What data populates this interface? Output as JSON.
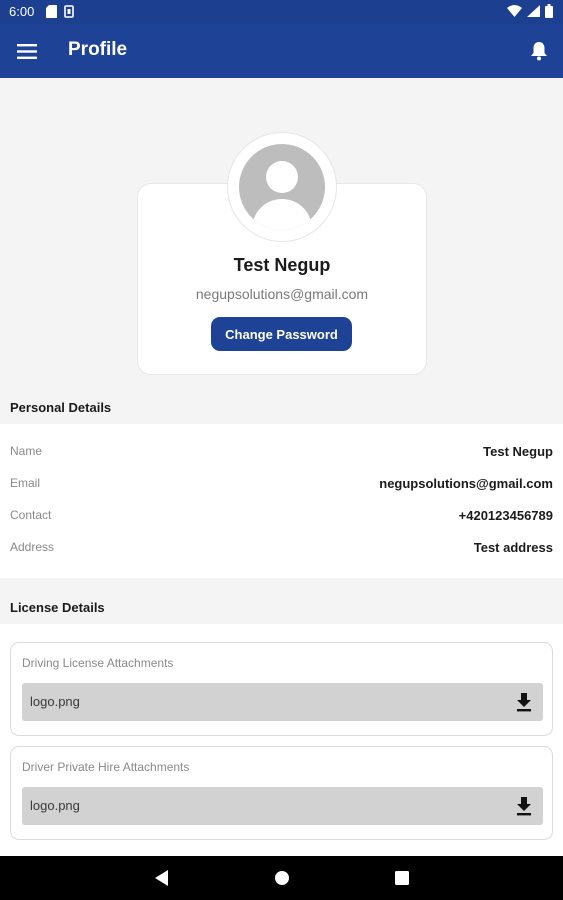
{
  "status_bar": {
    "time": "6:00"
  },
  "app_bar": {
    "title": "Profile"
  },
  "profile": {
    "name": "Test Negup",
    "email": "negupsolutions@gmail.com",
    "change_password_label": "Change Password"
  },
  "personal_details": {
    "title": "Personal Details",
    "rows": [
      {
        "label": "Name",
        "value": "Test Negup"
      },
      {
        "label": "Email",
        "value": "negupsolutions@gmail.com"
      },
      {
        "label": "Contact",
        "value": "+420123456789"
      },
      {
        "label": "Address",
        "value": "Test address"
      }
    ]
  },
  "license_details": {
    "title": "License Details",
    "attachments": [
      {
        "title": "Driving License Attachments",
        "file_name": "logo.png"
      },
      {
        "title": "Driver Private Hire Attachments",
        "file_name": "logo.png"
      }
    ]
  },
  "colors": {
    "primary": "#1e4295",
    "status_bar": "#1c3f8f",
    "background": "#f4f4f4"
  },
  "icons": [
    "menu-icon",
    "bell-icon",
    "download-icon",
    "back-icon",
    "home-icon",
    "recents-icon",
    "wifi-icon",
    "signal-icon",
    "battery-icon",
    "sd-card-icon",
    "sim-icon"
  ]
}
